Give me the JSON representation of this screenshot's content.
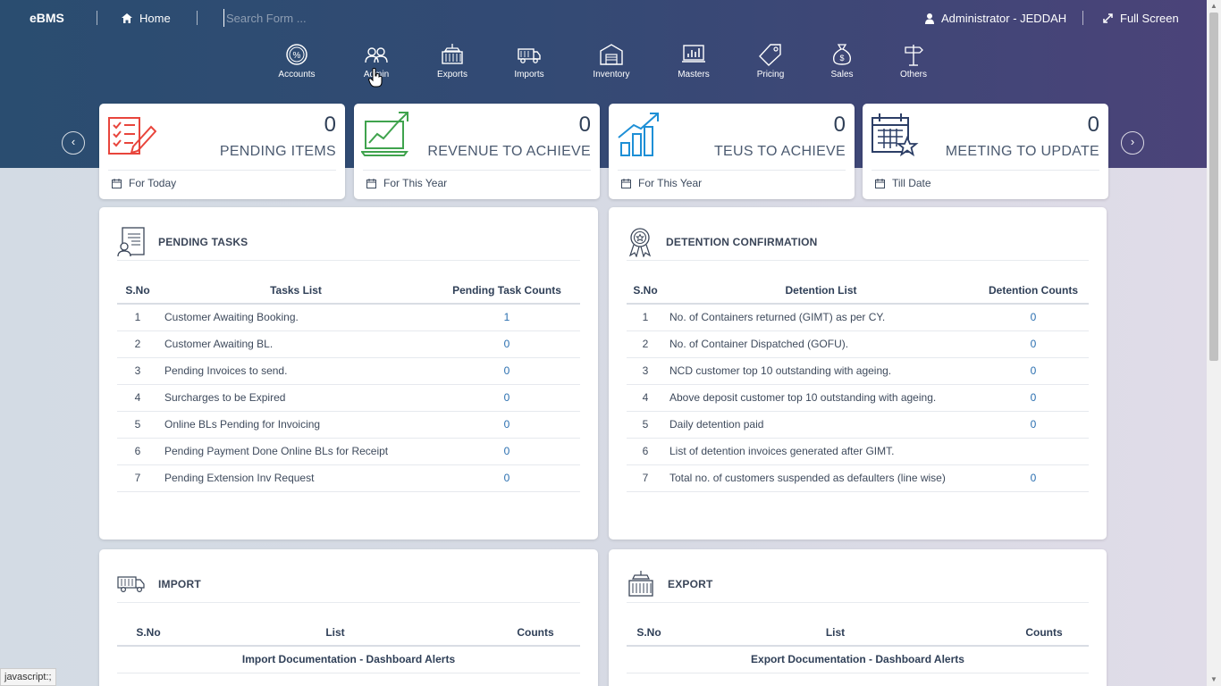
{
  "topbar": {
    "brand": "eBMS",
    "home_label": "Home",
    "search_placeholder": "Search Form ...",
    "user_label": "Administrator - JEDDAH",
    "fullscreen_label": "Full Screen"
  },
  "modules": [
    {
      "label": "Accounts",
      "icon": "percent-badge-icon"
    },
    {
      "label": "Admin",
      "icon": "users-icon"
    },
    {
      "label": "Exports",
      "icon": "container-crane-icon"
    },
    {
      "label": "Imports",
      "icon": "truck-icon"
    },
    {
      "label": "Inventory",
      "icon": "warehouse-icon"
    },
    {
      "label": "Masters",
      "icon": "chart-board-icon"
    },
    {
      "label": "Pricing",
      "icon": "price-tag-icon"
    },
    {
      "label": "Sales",
      "icon": "money-bag-icon"
    },
    {
      "label": "Others",
      "icon": "signpost-icon"
    }
  ],
  "kpis": [
    {
      "value": "0",
      "label": "PENDING ITEMS",
      "foot": "For Today",
      "icon": "checklist-pencil-icon",
      "color": "#e8453c"
    },
    {
      "value": "0",
      "label": "REVENUE TO ACHIEVE",
      "foot": "For This Year",
      "icon": "laptop-growth-icon",
      "color": "#3fa34d"
    },
    {
      "value": "0",
      "label": "TEUS TO ACHIEVE",
      "foot": "For This Year",
      "icon": "bar-growth-icon",
      "color": "#1d8fd6"
    },
    {
      "value": "0",
      "label": "MEETING TO UPDATE",
      "foot": "Till Date",
      "icon": "calendar-star-icon",
      "color": "#2c3e66"
    }
  ],
  "pending_tasks": {
    "title": "PENDING TASKS",
    "headers": [
      "S.No",
      "Tasks List",
      "Pending Task Counts"
    ],
    "rows": [
      {
        "sno": "1",
        "text": "Customer Awaiting Booking.",
        "count": "1"
      },
      {
        "sno": "2",
        "text": "Customer Awaiting BL.",
        "count": "0"
      },
      {
        "sno": "3",
        "text": "Pending Invoices to send.",
        "count": "0"
      },
      {
        "sno": "4",
        "text": "Surcharges to be Expired",
        "count": "0"
      },
      {
        "sno": "5",
        "text": "Online BLs Pending for Invoicing",
        "count": "0"
      },
      {
        "sno": "6",
        "text": "Pending Payment Done Online BLs for Receipt",
        "count": "0"
      },
      {
        "sno": "7",
        "text": "Pending Extension Inv Request",
        "count": "0"
      }
    ]
  },
  "detention": {
    "title": "DETENTION CONFIRMATION",
    "headers": [
      "S.No",
      "Detention List",
      "Detention Counts"
    ],
    "rows": [
      {
        "sno": "1",
        "text": "No. of Containers returned (GIMT) as per CY.",
        "count": "0"
      },
      {
        "sno": "2",
        "text": "No. of Container Dispatched (GOFU).",
        "count": "0"
      },
      {
        "sno": "3",
        "text": "NCD customer top 10 outstanding with ageing.",
        "count": "0"
      },
      {
        "sno": "4",
        "text": "Above deposit customer top 10 outstanding with ageing.",
        "count": "0"
      },
      {
        "sno": "5",
        "text": "Daily detention paid",
        "count": "0"
      },
      {
        "sno": "6",
        "text": "List of detention invoices generated after GIMT.",
        "count": ""
      },
      {
        "sno": "7",
        "text": "Total no. of customers suspended as defaulters (line wise)",
        "count": "0"
      }
    ]
  },
  "import": {
    "title": "IMPORT",
    "headers": [
      "S.No",
      "List",
      "Counts"
    ],
    "subheader": "Import Documentation - Dashboard Alerts"
  },
  "export": {
    "title": "EXPORT",
    "headers": [
      "S.No",
      "List",
      "Counts"
    ],
    "subheader": "Export Documentation - Dashboard Alerts"
  },
  "status_bar": "javascript:;",
  "colors": {
    "header_start": "#2a4d70",
    "header_end": "#4b4379",
    "link": "#2a6fb0"
  }
}
